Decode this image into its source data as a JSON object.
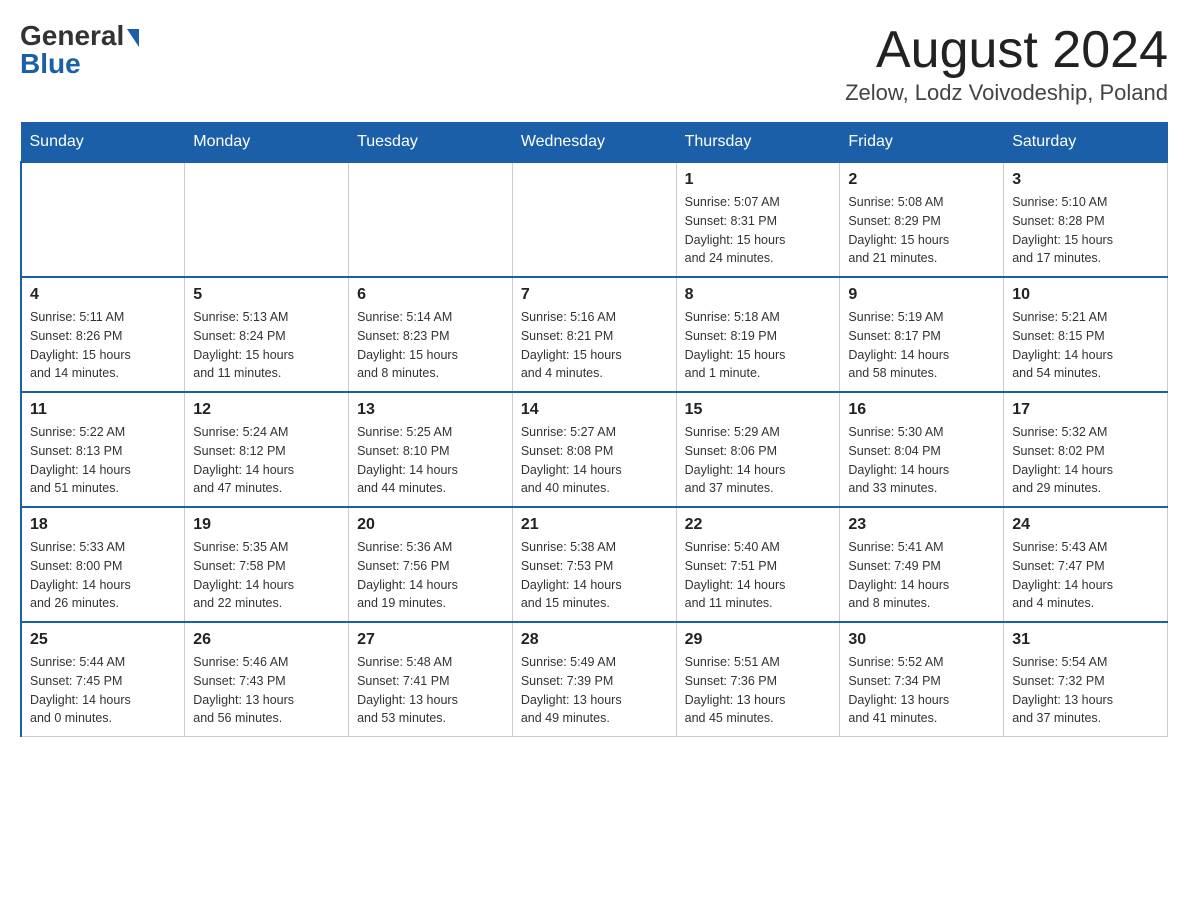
{
  "header": {
    "logo_general": "General",
    "logo_blue": "Blue",
    "title": "August 2024",
    "subtitle": "Zelow, Lodz Voivodeship, Poland"
  },
  "weekdays": [
    "Sunday",
    "Monday",
    "Tuesday",
    "Wednesday",
    "Thursday",
    "Friday",
    "Saturday"
  ],
  "weeks": [
    [
      {
        "day": "",
        "info": ""
      },
      {
        "day": "",
        "info": ""
      },
      {
        "day": "",
        "info": ""
      },
      {
        "day": "",
        "info": ""
      },
      {
        "day": "1",
        "info": "Sunrise: 5:07 AM\nSunset: 8:31 PM\nDaylight: 15 hours\nand 24 minutes."
      },
      {
        "day": "2",
        "info": "Sunrise: 5:08 AM\nSunset: 8:29 PM\nDaylight: 15 hours\nand 21 minutes."
      },
      {
        "day": "3",
        "info": "Sunrise: 5:10 AM\nSunset: 8:28 PM\nDaylight: 15 hours\nand 17 minutes."
      }
    ],
    [
      {
        "day": "4",
        "info": "Sunrise: 5:11 AM\nSunset: 8:26 PM\nDaylight: 15 hours\nand 14 minutes."
      },
      {
        "day": "5",
        "info": "Sunrise: 5:13 AM\nSunset: 8:24 PM\nDaylight: 15 hours\nand 11 minutes."
      },
      {
        "day": "6",
        "info": "Sunrise: 5:14 AM\nSunset: 8:23 PM\nDaylight: 15 hours\nand 8 minutes."
      },
      {
        "day": "7",
        "info": "Sunrise: 5:16 AM\nSunset: 8:21 PM\nDaylight: 15 hours\nand 4 minutes."
      },
      {
        "day": "8",
        "info": "Sunrise: 5:18 AM\nSunset: 8:19 PM\nDaylight: 15 hours\nand 1 minute."
      },
      {
        "day": "9",
        "info": "Sunrise: 5:19 AM\nSunset: 8:17 PM\nDaylight: 14 hours\nand 58 minutes."
      },
      {
        "day": "10",
        "info": "Sunrise: 5:21 AM\nSunset: 8:15 PM\nDaylight: 14 hours\nand 54 minutes."
      }
    ],
    [
      {
        "day": "11",
        "info": "Sunrise: 5:22 AM\nSunset: 8:13 PM\nDaylight: 14 hours\nand 51 minutes."
      },
      {
        "day": "12",
        "info": "Sunrise: 5:24 AM\nSunset: 8:12 PM\nDaylight: 14 hours\nand 47 minutes."
      },
      {
        "day": "13",
        "info": "Sunrise: 5:25 AM\nSunset: 8:10 PM\nDaylight: 14 hours\nand 44 minutes."
      },
      {
        "day": "14",
        "info": "Sunrise: 5:27 AM\nSunset: 8:08 PM\nDaylight: 14 hours\nand 40 minutes."
      },
      {
        "day": "15",
        "info": "Sunrise: 5:29 AM\nSunset: 8:06 PM\nDaylight: 14 hours\nand 37 minutes."
      },
      {
        "day": "16",
        "info": "Sunrise: 5:30 AM\nSunset: 8:04 PM\nDaylight: 14 hours\nand 33 minutes."
      },
      {
        "day": "17",
        "info": "Sunrise: 5:32 AM\nSunset: 8:02 PM\nDaylight: 14 hours\nand 29 minutes."
      }
    ],
    [
      {
        "day": "18",
        "info": "Sunrise: 5:33 AM\nSunset: 8:00 PM\nDaylight: 14 hours\nand 26 minutes."
      },
      {
        "day": "19",
        "info": "Sunrise: 5:35 AM\nSunset: 7:58 PM\nDaylight: 14 hours\nand 22 minutes."
      },
      {
        "day": "20",
        "info": "Sunrise: 5:36 AM\nSunset: 7:56 PM\nDaylight: 14 hours\nand 19 minutes."
      },
      {
        "day": "21",
        "info": "Sunrise: 5:38 AM\nSunset: 7:53 PM\nDaylight: 14 hours\nand 15 minutes."
      },
      {
        "day": "22",
        "info": "Sunrise: 5:40 AM\nSunset: 7:51 PM\nDaylight: 14 hours\nand 11 minutes."
      },
      {
        "day": "23",
        "info": "Sunrise: 5:41 AM\nSunset: 7:49 PM\nDaylight: 14 hours\nand 8 minutes."
      },
      {
        "day": "24",
        "info": "Sunrise: 5:43 AM\nSunset: 7:47 PM\nDaylight: 14 hours\nand 4 minutes."
      }
    ],
    [
      {
        "day": "25",
        "info": "Sunrise: 5:44 AM\nSunset: 7:45 PM\nDaylight: 14 hours\nand 0 minutes."
      },
      {
        "day": "26",
        "info": "Sunrise: 5:46 AM\nSunset: 7:43 PM\nDaylight: 13 hours\nand 56 minutes."
      },
      {
        "day": "27",
        "info": "Sunrise: 5:48 AM\nSunset: 7:41 PM\nDaylight: 13 hours\nand 53 minutes."
      },
      {
        "day": "28",
        "info": "Sunrise: 5:49 AM\nSunset: 7:39 PM\nDaylight: 13 hours\nand 49 minutes."
      },
      {
        "day": "29",
        "info": "Sunrise: 5:51 AM\nSunset: 7:36 PM\nDaylight: 13 hours\nand 45 minutes."
      },
      {
        "day": "30",
        "info": "Sunrise: 5:52 AM\nSunset: 7:34 PM\nDaylight: 13 hours\nand 41 minutes."
      },
      {
        "day": "31",
        "info": "Sunrise: 5:54 AM\nSunset: 7:32 PM\nDaylight: 13 hours\nand 37 minutes."
      }
    ]
  ]
}
